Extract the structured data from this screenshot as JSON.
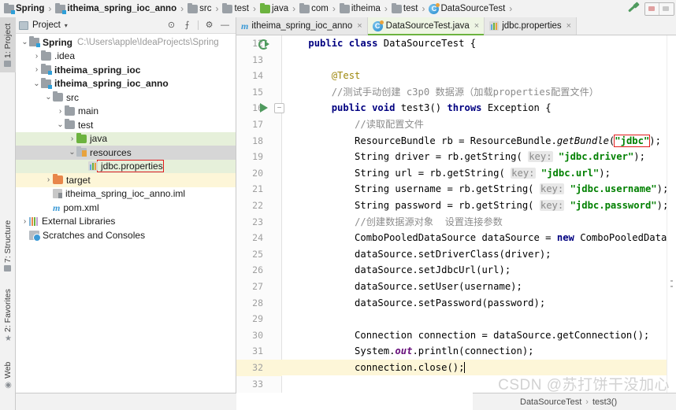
{
  "navbar": {
    "crumbs": [
      {
        "label": "Spring",
        "icon": "module-icon",
        "bold": true
      },
      {
        "label": "itheima_spring_ioc_anno",
        "icon": "module-icon",
        "bold": true
      },
      {
        "label": "src",
        "icon": "folder-icon",
        "bold": false
      },
      {
        "label": "test",
        "icon": "folder-icon",
        "bold": false
      },
      {
        "label": "java",
        "icon": "folder-green-icon",
        "bold": false
      },
      {
        "label": "com",
        "icon": "folder-icon",
        "bold": false
      },
      {
        "label": "itheima",
        "icon": "folder-icon",
        "bold": false
      },
      {
        "label": "test",
        "icon": "folder-icon",
        "bold": false
      },
      {
        "label": "DataSourceTest",
        "icon": "java-class-icon",
        "bold": false
      }
    ],
    "separator": "›",
    "build_icon": "hammer-icon"
  },
  "toolstrip": {
    "items": [
      {
        "label": "1: Project",
        "icon": "project-icon",
        "active": true
      },
      {
        "label": "7: Structure",
        "icon": "structure-icon",
        "active": false
      },
      {
        "label": "2: Favorites",
        "icon": "star-icon",
        "active": false
      },
      {
        "label": "Web",
        "icon": "web-icon",
        "active": false
      }
    ]
  },
  "project_panel": {
    "title": "Project",
    "caret": "▾",
    "tools": [
      {
        "name": "locate-icon",
        "glyph": "⊙"
      },
      {
        "name": "collapse-all-icon",
        "glyph": "⨍"
      },
      {
        "name": "settings-gear-icon",
        "glyph": "⚙"
      },
      {
        "name": "hide-icon",
        "glyph": "—"
      }
    ],
    "tree": [
      {
        "label": "Spring",
        "path": "C:\\Users\\apple\\IdeaProjects\\Spring",
        "indent": 0,
        "chevron": "⌄",
        "icon": "module-icon",
        "bold": true,
        "sel": ""
      },
      {
        "label": ".idea",
        "path": "",
        "indent": 1,
        "chevron": "›",
        "icon": "folder-icon",
        "bold": false,
        "sel": ""
      },
      {
        "label": "itheima_spring_ioc",
        "path": "",
        "indent": 1,
        "chevron": "›",
        "icon": "module-icon",
        "bold": true,
        "sel": ""
      },
      {
        "label": "itheima_spring_ioc_anno",
        "path": "",
        "indent": 1,
        "chevron": "⌄",
        "icon": "module-icon",
        "bold": true,
        "sel": ""
      },
      {
        "label": "src",
        "path": "",
        "indent": 2,
        "chevron": "⌄",
        "icon": "folder-icon",
        "bold": false,
        "sel": ""
      },
      {
        "label": "main",
        "path": "",
        "indent": 3,
        "chevron": "›",
        "icon": "folder-icon",
        "bold": false,
        "sel": ""
      },
      {
        "label": "test",
        "path": "",
        "indent": 3,
        "chevron": "⌄",
        "icon": "folder-icon",
        "bold": false,
        "sel": ""
      },
      {
        "label": "java",
        "path": "",
        "indent": 4,
        "chevron": "›",
        "icon": "folder-green-icon",
        "bold": false,
        "sel": "sel-green"
      },
      {
        "label": "resources",
        "path": "",
        "indent": 4,
        "chevron": "⌄",
        "icon": "resources-icon",
        "bold": false,
        "sel": "sel-gray"
      },
      {
        "label": "jdbc.properties",
        "path": "",
        "indent": 5,
        "chevron": "",
        "icon": "properties-icon",
        "bold": false,
        "sel": "sel-green",
        "highlight_box": true
      },
      {
        "label": "target",
        "path": "",
        "indent": 2,
        "chevron": "›",
        "icon": "folder-orange-icon",
        "bold": false,
        "sel": "sel-yellow"
      },
      {
        "label": "itheima_spring_ioc_anno.iml",
        "path": "",
        "indent": 2,
        "chevron": "",
        "icon": "iml-icon",
        "bold": false,
        "sel": ""
      },
      {
        "label": "pom.xml",
        "path": "",
        "indent": 2,
        "chevron": "",
        "icon": "maven-icon",
        "bold": false,
        "sel": ""
      },
      {
        "label": "External Libraries",
        "path": "",
        "indent": 0,
        "chevron": "›",
        "icon": "libraries-icon",
        "bold": false,
        "sel": ""
      },
      {
        "label": "Scratches and Consoles",
        "path": "",
        "indent": 0,
        "chevron": "",
        "icon": "scratches-icon",
        "bold": false,
        "sel": ""
      }
    ]
  },
  "editor": {
    "tabs": [
      {
        "label": "itheima_spring_ioc_anno",
        "icon": "maven-icon",
        "active": false,
        "close": "×"
      },
      {
        "label": "DataSourceTest.java",
        "icon": "java-class-icon",
        "active": true,
        "close": "×"
      },
      {
        "label": "jdbc.properties",
        "icon": "properties-icon",
        "active": false,
        "close": "×"
      }
    ],
    "first_line_number": 12,
    "highlight_line": 32,
    "lines": [
      {
        "n": 12,
        "gutter": "run-class-icon",
        "segments": [
          {
            "t": "    ",
            "c": ""
          },
          {
            "t": "public class ",
            "c": "kw"
          },
          {
            "t": "DataSourceTest {",
            "c": ""
          }
        ]
      },
      {
        "n": 13,
        "gutter": "",
        "segments": []
      },
      {
        "n": 14,
        "gutter": "",
        "segments": [
          {
            "t": "        ",
            "c": ""
          },
          {
            "t": "@Test",
            "c": "ann"
          }
        ]
      },
      {
        "n": 15,
        "gutter": "",
        "segments": [
          {
            "t": "        ",
            "c": ""
          },
          {
            "t": "//测试手动创建 c3p0 数据源（加载properties配置文件）",
            "c": "cmt"
          }
        ]
      },
      {
        "n": 16,
        "gutter": "run-method-icon",
        "fold": true,
        "segments": [
          {
            "t": "        ",
            "c": ""
          },
          {
            "t": "public void ",
            "c": "kw"
          },
          {
            "t": "test3() ",
            "c": ""
          },
          {
            "t": "throws ",
            "c": "kw"
          },
          {
            "t": "Exception {",
            "c": ""
          }
        ]
      },
      {
        "n": 17,
        "gutter": "",
        "segments": [
          {
            "t": "            ",
            "c": ""
          },
          {
            "t": "//读取配置文件",
            "c": "cmt"
          }
        ]
      },
      {
        "n": 18,
        "gutter": "",
        "highlight_box": true,
        "segments": [
          {
            "t": "            ResourceBundle rb = ResourceBundle.",
            "c": ""
          },
          {
            "t": "getBundle",
            "c": "mth"
          },
          {
            "t": "(",
            "c": ""
          },
          {
            "t": "\"jdbc\"",
            "c": "str"
          },
          {
            "t": ");",
            "c": ""
          }
        ]
      },
      {
        "n": 19,
        "gutter": "",
        "segments": [
          {
            "t": "            String driver = rb.getString( ",
            "c": ""
          },
          {
            "t": "key:",
            "c": "hint"
          },
          {
            "t": " ",
            "c": ""
          },
          {
            "t": "\"jdbc.driver\"",
            "c": "str"
          },
          {
            "t": ");",
            "c": ""
          }
        ]
      },
      {
        "n": 20,
        "gutter": "",
        "segments": [
          {
            "t": "            String url = rb.getString( ",
            "c": ""
          },
          {
            "t": "key:",
            "c": "hint"
          },
          {
            "t": " ",
            "c": ""
          },
          {
            "t": "\"jdbc.url\"",
            "c": "str"
          },
          {
            "t": ");",
            "c": ""
          }
        ]
      },
      {
        "n": 21,
        "gutter": "",
        "segments": [
          {
            "t": "            String username = rb.getString( ",
            "c": ""
          },
          {
            "t": "key:",
            "c": "hint"
          },
          {
            "t": " ",
            "c": ""
          },
          {
            "t": "\"jdbc.username\"",
            "c": "str"
          },
          {
            "t": ");",
            "c": ""
          }
        ]
      },
      {
        "n": 22,
        "gutter": "",
        "segments": [
          {
            "t": "            String password = rb.getString( ",
            "c": ""
          },
          {
            "t": "key:",
            "c": "hint"
          },
          {
            "t": " ",
            "c": ""
          },
          {
            "t": "\"jdbc.password\"",
            "c": "str"
          },
          {
            "t": ");",
            "c": ""
          }
        ]
      },
      {
        "n": 23,
        "gutter": "",
        "segments": [
          {
            "t": "            ",
            "c": ""
          },
          {
            "t": "//创建数据源对象  设置连接参数",
            "c": "cmt"
          }
        ]
      },
      {
        "n": 24,
        "gutter": "",
        "segments": [
          {
            "t": "            ComboPooledDataSource dataSource = ",
            "c": ""
          },
          {
            "t": "new ",
            "c": "kw"
          },
          {
            "t": "ComboPooledDataSource();",
            "c": ""
          }
        ]
      },
      {
        "n": 25,
        "gutter": "",
        "segments": [
          {
            "t": "            dataSource.setDriverClass(driver);",
            "c": ""
          }
        ]
      },
      {
        "n": 26,
        "gutter": "",
        "segments": [
          {
            "t": "            dataSource.setJdbcUrl(url);",
            "c": ""
          }
        ]
      },
      {
        "n": 27,
        "gutter": "",
        "segments": [
          {
            "t": "            dataSource.setUser(username);",
            "c": ""
          }
        ]
      },
      {
        "n": 28,
        "gutter": "",
        "segments": [
          {
            "t": "            dataSource.setPassword(password);",
            "c": ""
          }
        ]
      },
      {
        "n": 29,
        "gutter": "",
        "segments": []
      },
      {
        "n": 30,
        "gutter": "",
        "segments": [
          {
            "t": "            Connection connection = dataSource.getConnection();",
            "c": ""
          }
        ]
      },
      {
        "n": 31,
        "gutter": "",
        "segments": [
          {
            "t": "            System.",
            "c": ""
          },
          {
            "t": "out",
            "c": "fld"
          },
          {
            "t": ".println(connection);",
            "c": ""
          }
        ]
      },
      {
        "n": 32,
        "gutter": "",
        "caret": true,
        "segments": [
          {
            "t": "            connection.close();",
            "c": ""
          }
        ]
      },
      {
        "n": 33,
        "gutter": "",
        "segments": []
      }
    ]
  },
  "statusbar": {
    "breadcrumb": [
      "DataSourceTest",
      "test3()"
    ],
    "separator": "›"
  },
  "watermark": "CSDN @苏打饼干没加心"
}
